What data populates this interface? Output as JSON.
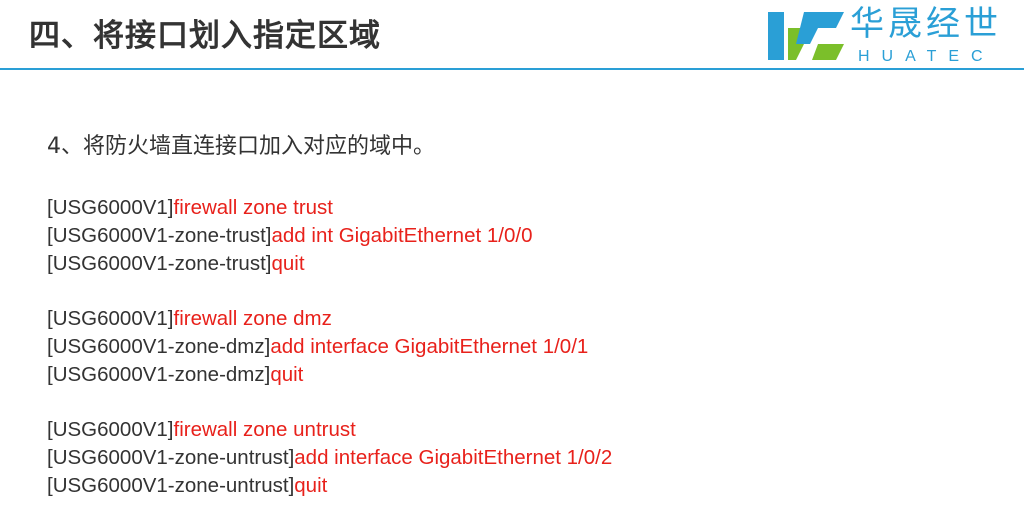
{
  "header": {
    "title": "四、将接口划入指定区域",
    "logo_cn": "华晟经世",
    "logo_en": "HUATEC"
  },
  "content": {
    "step": "4、将防火墙直连接口加入对应的域中。",
    "blocks": [
      {
        "lines": [
          {
            "prompt": "[USG6000V1]",
            "command": "firewall zone trust"
          },
          {
            "prompt": "[USG6000V1-zone-trust]",
            "command": "add int GigabitEthernet 1/0/0"
          },
          {
            "prompt": "[USG6000V1-zone-trust]",
            "command": "quit"
          }
        ]
      },
      {
        "lines": [
          {
            "prompt": "[USG6000V1]",
            "command": "firewall zone dmz"
          },
          {
            "prompt": "[USG6000V1-zone-dmz]",
            "command": "add interface GigabitEthernet 1/0/1"
          },
          {
            "prompt": "[USG6000V1-zone-dmz]",
            "command": "quit"
          }
        ]
      },
      {
        "lines": [
          {
            "prompt": "[USG6000V1]",
            "command": "firewall zone untrust"
          },
          {
            "prompt": "[USG6000V1-zone-untrust]",
            "command": "add interface GigabitEthernet 1/0/2"
          },
          {
            "prompt": "[USG6000V1-zone-untrust]",
            "command": "quit"
          }
        ]
      }
    ]
  },
  "colors": {
    "command": "#e8211b",
    "text": "#333333",
    "accent": "#2a9fd6",
    "logo_green": "#7bbf2a"
  }
}
